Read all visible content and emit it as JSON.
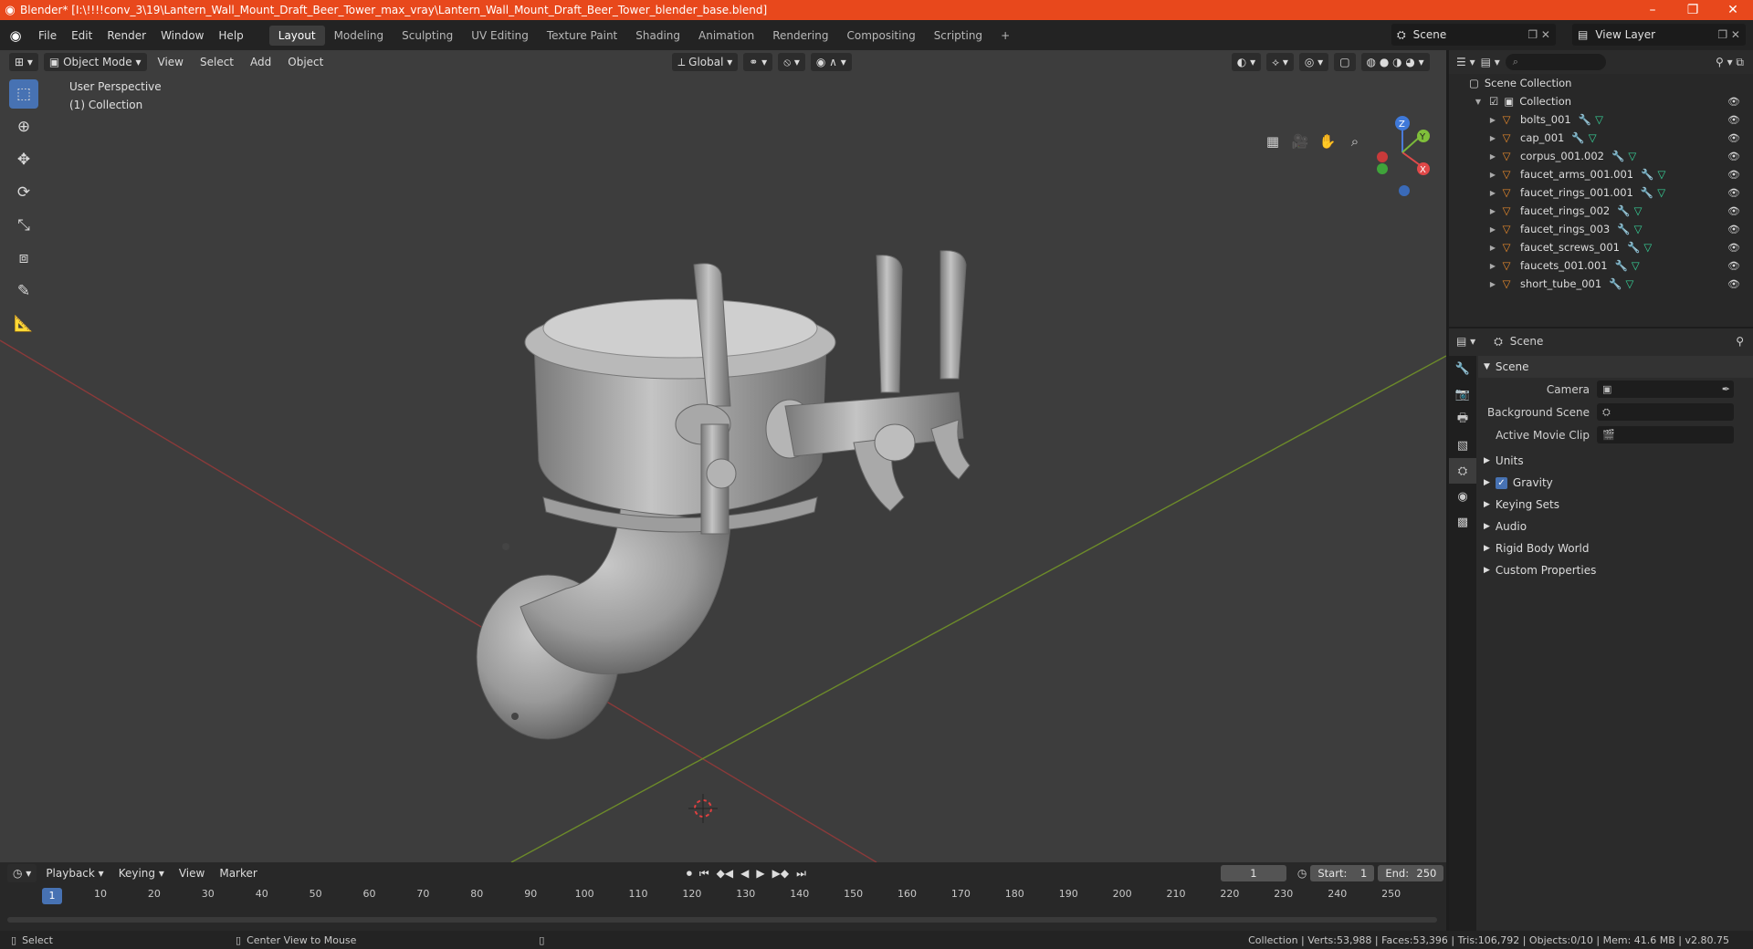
{
  "window": {
    "title": "Blender* [I:\\!!!!conv_3\\19\\Lantern_Wall_Mount_Draft_Beer_Tower_max_vray\\Lantern_Wall_Mount_Draft_Beer_Tower_blender_base.blend]",
    "minimize": "–",
    "maximize": "❐",
    "close": "✕"
  },
  "menu": [
    "File",
    "Edit",
    "Render",
    "Window",
    "Help"
  ],
  "workspaces": [
    "Layout",
    "Modeling",
    "Sculpting",
    "UV Editing",
    "Texture Paint",
    "Shading",
    "Animation",
    "Rendering",
    "Compositing",
    "Scripting"
  ],
  "workspace_add": "+",
  "scene_name": "Scene",
  "view_layer_name": "View Layer",
  "viewport": {
    "mode": "Object Mode",
    "menus": [
      "View",
      "Select",
      "Add",
      "Object"
    ],
    "orientation": "Global",
    "info_line1": "User Perspective",
    "info_line2": "(1) Collection",
    "gizmo": {
      "z": "Z",
      "y": "Y",
      "x": "X"
    }
  },
  "outliner": {
    "root": "Scene Collection",
    "collection": "Collection",
    "objects": [
      "bolts_001",
      "cap_001",
      "corpus_001.002",
      "faucet_arms_001.001",
      "faucet_rings_001.001",
      "faucet_rings_002",
      "faucet_rings_003",
      "faucet_screws_001",
      "faucets_001.001",
      "short_tube_001"
    ]
  },
  "properties": {
    "context": "Scene",
    "section": "Scene",
    "fields": [
      {
        "label": "Camera"
      },
      {
        "label": "Background Scene"
      },
      {
        "label": "Active Movie Clip"
      }
    ],
    "collapsed": [
      "Units",
      "Gravity",
      "Keying Sets",
      "Audio",
      "Rigid Body World",
      "Custom Properties"
    ]
  },
  "timeline": {
    "menus": [
      "Playback",
      "Keying",
      "View",
      "Marker"
    ],
    "current_frame": "1",
    "start_label": "Start:",
    "start": "1",
    "end_label": "End:",
    "end": "250",
    "ticks": [
      "10",
      "20",
      "30",
      "40",
      "50",
      "60",
      "70",
      "80",
      "90",
      "100",
      "110",
      "120",
      "130",
      "140",
      "150",
      "160",
      "170",
      "180",
      "190",
      "200",
      "210",
      "220",
      "230",
      "240",
      "250"
    ]
  },
  "status": {
    "left": "Select",
    "middle": "Center View to Mouse",
    "right": "Collection | Verts:53,988 | Faces:53,396 | Tris:106,792 | Objects:0/10 | Mem: 41.6 MB | v2.80.75"
  }
}
